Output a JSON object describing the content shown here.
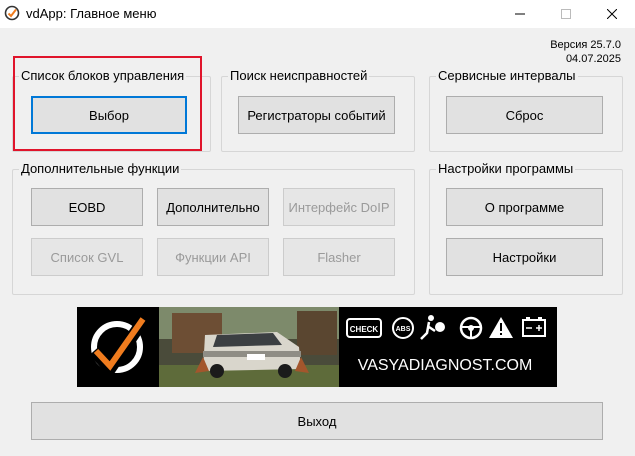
{
  "window": {
    "title": "vdApp:  Главное меню",
    "minimize_icon": "minimize-icon",
    "maximize_icon": "maximize-icon",
    "close_icon": "close-icon"
  },
  "version": {
    "label": "Версия 25.7.0",
    "date": "04.07.2025"
  },
  "groups": {
    "control_units": {
      "title": "Список блоков управления",
      "select_button": "Выбор"
    },
    "fault_search": {
      "title": "Поиск неисправностей",
      "event_recorders_button": "Регистраторы событий"
    },
    "service_intervals": {
      "title": "Сервисные интервалы",
      "reset_button": "Сброс"
    },
    "additional_functions": {
      "title": "Дополнительные функции",
      "eobd_button": "EOBD",
      "additional_button": "Дополнительно",
      "doip_button": "Интерфейс DoIP",
      "gvl_button": "Список GVL",
      "api_button": "Функции API",
      "flasher_button": "Flasher"
    },
    "program_settings": {
      "title": "Настройки программы",
      "about_button": "О программе",
      "settings_button": "Настройки"
    }
  },
  "banner": {
    "site": "VASYADIAGNOST.COM",
    "plate": "B 044 BAT",
    "icons": [
      "check-engine-icon",
      "abs-icon",
      "airbag-icon",
      "steering-wheel-icon",
      "warning-triangle-icon",
      "battery-icon"
    ],
    "icon_labels": {
      "check": "CHECK",
      "abs": "ABS"
    }
  },
  "exit_button": "Выход",
  "colors": {
    "accent": "#0078d7",
    "highlight": "#e0142b",
    "brand_orange": "#f07c1e"
  }
}
